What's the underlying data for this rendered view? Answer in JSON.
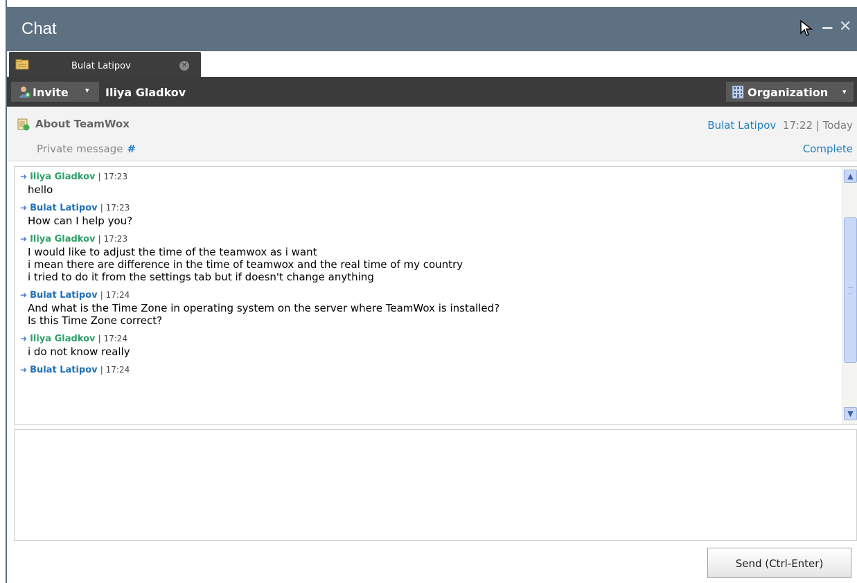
{
  "window": {
    "title": "Chat",
    "minimize_glyph": "‒",
    "close_glyph": "✕"
  },
  "tabs": [
    {
      "label": "Bulat Latipov",
      "icon": "chat-tab-icon",
      "close_glyph": "✕"
    }
  ],
  "toolbar": {
    "invite_label": "Invite",
    "invite_caret": "▾",
    "contact_name": "Iliya Gladkov",
    "organization_label": "Organization",
    "organization_caret": "▾"
  },
  "info": {
    "topic": "About TeamWox",
    "author": "Bulat Latipov",
    "time_date": "17:22 | Today",
    "private_label": "Private message",
    "hash": "#",
    "complete_label": "Complete"
  },
  "messages": [
    {
      "author": "Iliya Gladkov",
      "time": "| 17:23",
      "color": "green",
      "lines": [
        "hello"
      ]
    },
    {
      "author": "Bulat Latipov",
      "time": "| 17:23",
      "color": "blue",
      "lines": [
        "How can I help you?"
      ]
    },
    {
      "author": "Iliya Gladkov",
      "time": "| 17:23",
      "color": "green",
      "lines": [
        "I would like to adjust the time of the teamwox as i want",
        "i mean there are difference in the time of teamwox and the real time of my country",
        "i tried to do it from the settings tab but if doesn't change anything"
      ]
    },
    {
      "author": "Bulat Latipov",
      "time": "| 17:24",
      "color": "blue",
      "lines": [
        "And what is the Time Zone in operating system on the server where TeamWox is installed?",
        "Is this Time Zone correct?"
      ]
    },
    {
      "author": "Iliya Gladkov",
      "time": "| 17:24",
      "color": "green",
      "lines": [
        "i do not know really"
      ]
    },
    {
      "author": "Bulat Latipov",
      "time": "| 17:24",
      "color": "blue",
      "lines": []
    }
  ],
  "compose": {
    "value": "",
    "send_label": "Send (Ctrl-Enter)"
  },
  "colors": {
    "titlebar": "#5e7182",
    "toolbar": "#3b3b3b",
    "author_green": "#2f9f6a",
    "author_blue": "#2070b8",
    "link_blue": "#1f7fc1"
  }
}
